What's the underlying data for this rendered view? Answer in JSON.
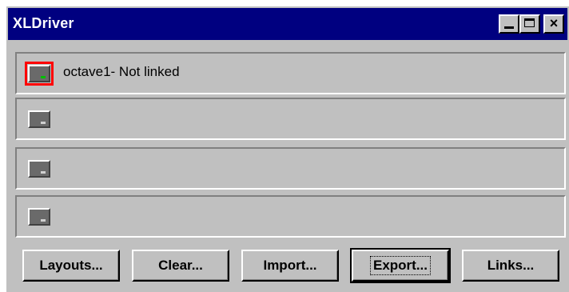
{
  "window": {
    "title": "XLDriver"
  },
  "title_buttons": {
    "minimize": "minimize-icon",
    "maximize": "maximize-icon",
    "close": "×"
  },
  "slots": [
    {
      "label": "octave1- Not linked",
      "active": true
    },
    {
      "label": "",
      "active": false
    },
    {
      "label": "",
      "active": false
    },
    {
      "label": "",
      "active": false
    }
  ],
  "buttons": {
    "layouts": "Layouts...",
    "clear": "Clear...",
    "import": "Import...",
    "export": "Export...",
    "links": "Links..."
  },
  "colors": {
    "titlebar": "#000080",
    "face": "#c0c0c0",
    "active_outline": "#ff0000",
    "active_led": "#00c000"
  }
}
